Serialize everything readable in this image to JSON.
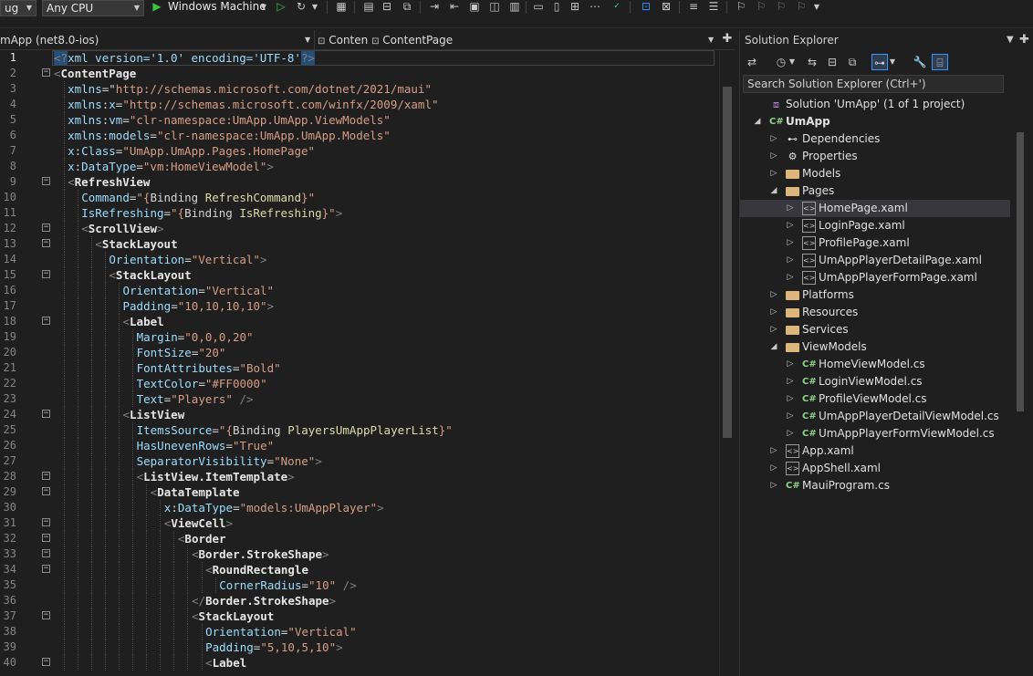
{
  "toolbar": {
    "config_combo": "ug",
    "platform_combo": "Any CPU",
    "run_target": "Windows Machine"
  },
  "editor": {
    "nav_left": "mApp (net8.0-ios)",
    "nav_right_short": "Conten",
    "nav_right_full": "ContentPage"
  },
  "code_lines": [
    {
      "n": "1",
      "indent": 0,
      "tokens": [
        {
          "t": "<?",
          "c": "t-br sel"
        },
        {
          "t": "xml version='1.0' encoding='UTF-8'",
          "c": "t-pi"
        },
        {
          "t": "?>",
          "c": "t-br sel"
        }
      ]
    },
    {
      "n": "2",
      "indent": 0,
      "tokens": [
        {
          "t": "<",
          "c": "t-br"
        },
        {
          "t": "ContentPage",
          "c": "t-el"
        }
      ]
    },
    {
      "n": "3",
      "indent": 1,
      "tokens": [
        {
          "t": "xmlns",
          "c": "t-attr"
        },
        {
          "t": "=\"",
          "c": "t-eq"
        },
        {
          "t": "http://schemas.microsoft.com/dotnet/2021/maui",
          "c": "t-str"
        },
        {
          "t": "\"",
          "c": "t-str"
        }
      ]
    },
    {
      "n": "4",
      "indent": 1,
      "tokens": [
        {
          "t": "xmlns",
          "c": "t-attr"
        },
        {
          "t": ":",
          "c": "t-eq"
        },
        {
          "t": "x",
          "c": "t-attr"
        },
        {
          "t": "=",
          "c": "t-eq"
        },
        {
          "t": "\"http://schemas.microsoft.com/winfx/2009/xaml\"",
          "c": "t-str"
        }
      ]
    },
    {
      "n": "5",
      "indent": 1,
      "tokens": [
        {
          "t": "xmlns",
          "c": "t-attr"
        },
        {
          "t": ":",
          "c": "t-eq"
        },
        {
          "t": "vm",
          "c": "t-attr"
        },
        {
          "t": "=",
          "c": "t-eq"
        },
        {
          "t": "\"clr-namespace:UmApp.UmApp.ViewModels\"",
          "c": "t-str"
        }
      ]
    },
    {
      "n": "6",
      "indent": 1,
      "tokens": [
        {
          "t": "xmlns",
          "c": "t-attr"
        },
        {
          "t": ":",
          "c": "t-eq"
        },
        {
          "t": "models",
          "c": "t-attr"
        },
        {
          "t": "=",
          "c": "t-eq"
        },
        {
          "t": "\"clr-namespace:UmApp.UmApp.Models\"",
          "c": "t-str"
        }
      ]
    },
    {
      "n": "7",
      "indent": 1,
      "tokens": [
        {
          "t": "x",
          "c": "t-attr"
        },
        {
          "t": ":",
          "c": "t-eq"
        },
        {
          "t": "Class",
          "c": "t-attr"
        },
        {
          "t": "=",
          "c": "t-eq"
        },
        {
          "t": "\"UmApp.UmApp.Pages.HomePage\"",
          "c": "t-str"
        }
      ]
    },
    {
      "n": "8",
      "indent": 1,
      "tokens": [
        {
          "t": "x",
          "c": "t-attr"
        },
        {
          "t": ":",
          "c": "t-eq"
        },
        {
          "t": "DataType",
          "c": "t-attr"
        },
        {
          "t": "=",
          "c": "t-eq"
        },
        {
          "t": "\"vm:HomeViewModel\"",
          "c": "t-str"
        },
        {
          "t": ">",
          "c": "t-br"
        }
      ]
    },
    {
      "n": "9",
      "indent": 1,
      "tokens": [
        {
          "t": "<",
          "c": "t-br"
        },
        {
          "t": "RefreshView",
          "c": "t-el"
        }
      ]
    },
    {
      "n": "10",
      "indent": 2,
      "tokens": [
        {
          "t": "Command",
          "c": "t-attr"
        },
        {
          "t": "=",
          "c": "t-eq"
        },
        {
          "t": "\"{",
          "c": "t-str"
        },
        {
          "t": "Binding ",
          "c": "t-bind"
        },
        {
          "t": "RefreshCommand",
          "c": "t-bindval"
        },
        {
          "t": "}\"",
          "c": "t-str"
        }
      ]
    },
    {
      "n": "11",
      "indent": 2,
      "tokens": [
        {
          "t": "IsRefreshing",
          "c": "t-attr"
        },
        {
          "t": "=",
          "c": "t-eq"
        },
        {
          "t": "\"{",
          "c": "t-str"
        },
        {
          "t": "Binding ",
          "c": "t-bind"
        },
        {
          "t": "IsRefreshing",
          "c": "t-bindval"
        },
        {
          "t": "}\"",
          "c": "t-str"
        },
        {
          "t": ">",
          "c": "t-br"
        }
      ]
    },
    {
      "n": "12",
      "indent": 2,
      "tokens": [
        {
          "t": "<",
          "c": "t-br"
        },
        {
          "t": "ScrollView",
          "c": "t-el"
        },
        {
          "t": ">",
          "c": "t-br"
        }
      ]
    },
    {
      "n": "13",
      "indent": 3,
      "tokens": [
        {
          "t": "<",
          "c": "t-br"
        },
        {
          "t": "StackLayout",
          "c": "t-el"
        }
      ]
    },
    {
      "n": "14",
      "indent": 4,
      "tokens": [
        {
          "t": "Orientation",
          "c": "t-attr"
        },
        {
          "t": "=",
          "c": "t-eq"
        },
        {
          "t": "\"Vertical\"",
          "c": "t-str"
        },
        {
          "t": ">",
          "c": "t-br"
        }
      ]
    },
    {
      "n": "15",
      "indent": 4,
      "tokens": [
        {
          "t": "<",
          "c": "t-br"
        },
        {
          "t": "StackLayout",
          "c": "t-el"
        }
      ]
    },
    {
      "n": "16",
      "indent": 5,
      "tokens": [
        {
          "t": "Orientation",
          "c": "t-attr"
        },
        {
          "t": "=",
          "c": "t-eq"
        },
        {
          "t": "\"Vertical\"",
          "c": "t-str"
        }
      ]
    },
    {
      "n": "17",
      "indent": 5,
      "tokens": [
        {
          "t": "Padding",
          "c": "t-attr"
        },
        {
          "t": "=",
          "c": "t-eq"
        },
        {
          "t": "\"10,10,10,10\"",
          "c": "t-str"
        },
        {
          "t": ">",
          "c": "t-br"
        }
      ]
    },
    {
      "n": "18",
      "indent": 5,
      "tokens": [
        {
          "t": "<",
          "c": "t-br"
        },
        {
          "t": "Label",
          "c": "t-el"
        }
      ]
    },
    {
      "n": "19",
      "indent": 6,
      "tokens": [
        {
          "t": "Margin",
          "c": "t-attr"
        },
        {
          "t": "=",
          "c": "t-eq"
        },
        {
          "t": "\"0,0,0,20\"",
          "c": "t-str"
        }
      ]
    },
    {
      "n": "20",
      "indent": 6,
      "tokens": [
        {
          "t": "FontSize",
          "c": "t-attr"
        },
        {
          "t": "=",
          "c": "t-eq"
        },
        {
          "t": "\"20\"",
          "c": "t-str"
        }
      ]
    },
    {
      "n": "21",
      "indent": 6,
      "tokens": [
        {
          "t": "FontAttributes",
          "c": "t-attr"
        },
        {
          "t": "=",
          "c": "t-eq"
        },
        {
          "t": "\"Bold\"",
          "c": "t-str"
        }
      ]
    },
    {
      "n": "22",
      "indent": 6,
      "tokens": [
        {
          "t": "TextColor",
          "c": "t-attr"
        },
        {
          "t": "=",
          "c": "t-eq"
        },
        {
          "t": "\"#FF0000\"",
          "c": "t-str"
        }
      ]
    },
    {
      "n": "23",
      "indent": 6,
      "tokens": [
        {
          "t": "Text",
          "c": "t-attr"
        },
        {
          "t": "=",
          "c": "t-eq"
        },
        {
          "t": "\"Players\"",
          "c": "t-str"
        },
        {
          "t": " />",
          "c": "t-br"
        }
      ]
    },
    {
      "n": "24",
      "indent": 5,
      "tokens": [
        {
          "t": "<",
          "c": "t-br"
        },
        {
          "t": "ListView",
          "c": "t-el"
        }
      ]
    },
    {
      "n": "25",
      "indent": 6,
      "tokens": [
        {
          "t": "ItemsSource",
          "c": "t-attr"
        },
        {
          "t": "=",
          "c": "t-eq"
        },
        {
          "t": "\"{",
          "c": "t-str"
        },
        {
          "t": "Binding ",
          "c": "t-bind"
        },
        {
          "t": "PlayersUmAppPlayerList",
          "c": "t-bindval"
        },
        {
          "t": "}\"",
          "c": "t-str"
        }
      ]
    },
    {
      "n": "26",
      "indent": 6,
      "tokens": [
        {
          "t": "HasUnevenRows",
          "c": "t-attr"
        },
        {
          "t": "=",
          "c": "t-eq"
        },
        {
          "t": "\"True\"",
          "c": "t-str"
        }
      ]
    },
    {
      "n": "27",
      "indent": 6,
      "tokens": [
        {
          "t": "SeparatorVisibility",
          "c": "t-attr"
        },
        {
          "t": "=",
          "c": "t-eq"
        },
        {
          "t": "\"None\"",
          "c": "t-str"
        },
        {
          "t": ">",
          "c": "t-br"
        }
      ]
    },
    {
      "n": "28",
      "indent": 6,
      "tokens": [
        {
          "t": "<",
          "c": "t-br"
        },
        {
          "t": "ListView.ItemTemplate",
          "c": "t-el"
        },
        {
          "t": ">",
          "c": "t-br"
        }
      ]
    },
    {
      "n": "29",
      "indent": 7,
      "tokens": [
        {
          "t": "<",
          "c": "t-br"
        },
        {
          "t": "DataTemplate",
          "c": "t-el"
        }
      ]
    },
    {
      "n": "30",
      "indent": 8,
      "tokens": [
        {
          "t": "x",
          "c": "t-attr"
        },
        {
          "t": ":",
          "c": "t-eq"
        },
        {
          "t": "DataType",
          "c": "t-attr"
        },
        {
          "t": "=",
          "c": "t-eq"
        },
        {
          "t": "\"models:UmAppPlayer\"",
          "c": "t-str"
        },
        {
          "t": ">",
          "c": "t-br"
        }
      ]
    },
    {
      "n": "31",
      "indent": 8,
      "tokens": [
        {
          "t": "<",
          "c": "t-br"
        },
        {
          "t": "ViewCell",
          "c": "t-el"
        },
        {
          "t": ">",
          "c": "t-br"
        }
      ]
    },
    {
      "n": "32",
      "indent": 9,
      "tokens": [
        {
          "t": "<",
          "c": "t-br"
        },
        {
          "t": "Border",
          "c": "t-el"
        }
      ]
    },
    {
      "n": "33",
      "indent": 10,
      "tokens": [
        {
          "t": "<",
          "c": "t-br"
        },
        {
          "t": "Border.StrokeShape",
          "c": "t-el"
        },
        {
          "t": ">",
          "c": "t-br"
        }
      ]
    },
    {
      "n": "34",
      "indent": 11,
      "tokens": [
        {
          "t": "<",
          "c": "t-br"
        },
        {
          "t": "RoundRectangle",
          "c": "t-el"
        }
      ]
    },
    {
      "n": "35",
      "indent": 12,
      "tokens": [
        {
          "t": "CornerRadius",
          "c": "t-attr"
        },
        {
          "t": "=",
          "c": "t-eq"
        },
        {
          "t": "\"10\"",
          "c": "t-str"
        },
        {
          "t": " />",
          "c": "t-br"
        }
      ]
    },
    {
      "n": "36",
      "indent": 10,
      "tokens": [
        {
          "t": "</",
          "c": "t-br"
        },
        {
          "t": "Border.StrokeShape",
          "c": "t-el"
        },
        {
          "t": ">",
          "c": "t-br"
        }
      ]
    },
    {
      "n": "37",
      "indent": 10,
      "tokens": [
        {
          "t": "<",
          "c": "t-br"
        },
        {
          "t": "StackLayout",
          "c": "t-el"
        }
      ]
    },
    {
      "n": "38",
      "indent": 11,
      "tokens": [
        {
          "t": "Orientation",
          "c": "t-attr"
        },
        {
          "t": "=",
          "c": "t-eq"
        },
        {
          "t": "\"Vertical\"",
          "c": "t-str"
        }
      ]
    },
    {
      "n": "39",
      "indent": 11,
      "tokens": [
        {
          "t": "Padding",
          "c": "t-attr"
        },
        {
          "t": "=",
          "c": "t-eq"
        },
        {
          "t": "\"5,10,5,10\"",
          "c": "t-str"
        },
        {
          "t": ">",
          "c": "t-br"
        }
      ]
    },
    {
      "n": "40",
      "indent": 11,
      "tokens": [
        {
          "t": "<",
          "c": "t-br"
        },
        {
          "t": "Label",
          "c": "t-el"
        }
      ]
    }
  ],
  "fold_lines": [
    "2",
    "9",
    "12",
    "13",
    "15",
    "18",
    "24",
    "28",
    "29",
    "31",
    "32",
    "33",
    "34",
    "37",
    "40"
  ],
  "solution_explorer": {
    "title": "Solution Explorer",
    "search_placeholder": "Search Solution Explorer (Ctrl+')",
    "tree": [
      {
        "label": "Solution 'UmApp' (1 of 1 project)",
        "level": 0,
        "icon": "solution-icon",
        "exp": ""
      },
      {
        "label": "UmApp",
        "level": 0,
        "icon": "csharp-project-icon",
        "exp": "open",
        "bold": true
      },
      {
        "label": "Dependencies",
        "level": 1,
        "icon": "dependencies-icon",
        "exp": "closed"
      },
      {
        "label": "Properties",
        "level": 1,
        "icon": "properties-icon",
        "exp": "closed"
      },
      {
        "label": "Models",
        "level": 1,
        "icon": "folder-icon",
        "exp": "closed"
      },
      {
        "label": "Pages",
        "level": 1,
        "icon": "folder-icon",
        "exp": "open"
      },
      {
        "label": "HomePage.xaml",
        "level": 2,
        "icon": "xaml-file-icon",
        "exp": "closed",
        "selected": true
      },
      {
        "label": "LoginPage.xaml",
        "level": 2,
        "icon": "xaml-file-icon",
        "exp": "closed"
      },
      {
        "label": "ProfilePage.xaml",
        "level": 2,
        "icon": "xaml-file-icon",
        "exp": "closed"
      },
      {
        "label": "UmAppPlayerDetailPage.xaml",
        "level": 2,
        "icon": "xaml-file-icon",
        "exp": "closed"
      },
      {
        "label": "UmAppPlayerFormPage.xaml",
        "level": 2,
        "icon": "xaml-file-icon",
        "exp": "closed"
      },
      {
        "label": "Platforms",
        "level": 1,
        "icon": "folder-icon",
        "exp": "closed"
      },
      {
        "label": "Resources",
        "level": 1,
        "icon": "folder-icon",
        "exp": "closed"
      },
      {
        "label": "Services",
        "level": 1,
        "icon": "folder-icon",
        "exp": "closed"
      },
      {
        "label": "ViewModels",
        "level": 1,
        "icon": "folder-icon",
        "exp": "open"
      },
      {
        "label": "HomeViewModel.cs",
        "level": 2,
        "icon": "csharp-file-icon",
        "exp": "closed"
      },
      {
        "label": "LoginViewModel.cs",
        "level": 2,
        "icon": "csharp-file-icon",
        "exp": "closed"
      },
      {
        "label": "ProfileViewModel.cs",
        "level": 2,
        "icon": "csharp-file-icon",
        "exp": "closed"
      },
      {
        "label": "UmAppPlayerDetailViewModel.cs",
        "level": 2,
        "icon": "csharp-file-icon",
        "exp": "closed"
      },
      {
        "label": "UmAppPlayerFormViewModel.cs",
        "level": 2,
        "icon": "csharp-file-icon",
        "exp": "closed"
      },
      {
        "label": "App.xaml",
        "level": 1,
        "icon": "xaml-file-icon",
        "exp": "closed"
      },
      {
        "label": "AppShell.xaml",
        "level": 1,
        "icon": "xaml-file-icon",
        "exp": "closed"
      },
      {
        "label": "MauiProgram.cs",
        "level": 1,
        "icon": "csharp-file-icon",
        "exp": "closed"
      }
    ]
  }
}
